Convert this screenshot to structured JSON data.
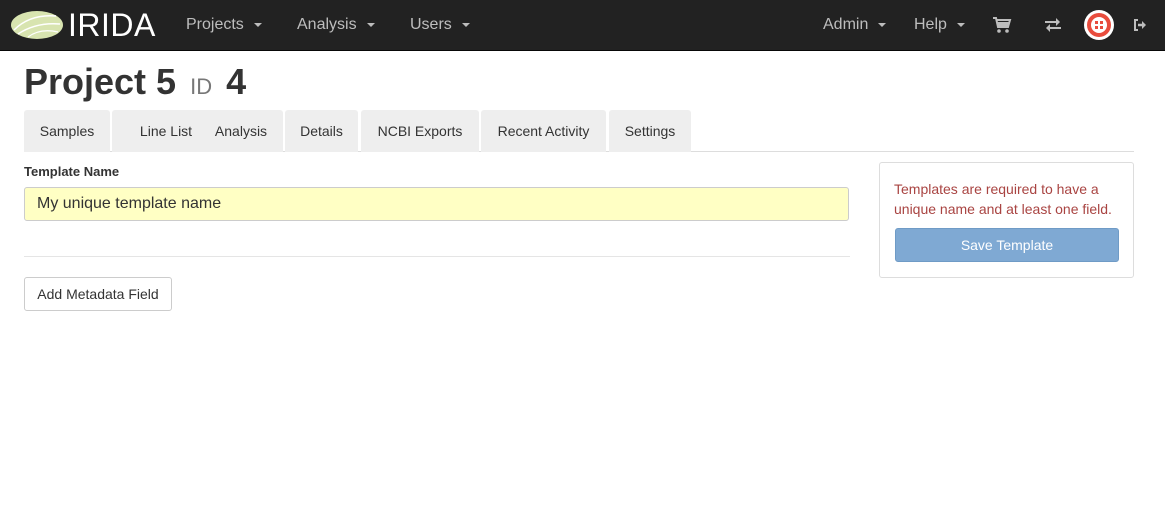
{
  "navbar": {
    "brand": "IRIDA",
    "menu": [
      {
        "label": "Projects"
      },
      {
        "label": "Analysis"
      },
      {
        "label": "Users"
      }
    ],
    "right_menu": [
      {
        "label": "Admin"
      },
      {
        "label": "Help"
      }
    ],
    "icons": [
      "shopping-cart-icon",
      "transfer-icon",
      "user-avatar",
      "sign-out-icon"
    ]
  },
  "page": {
    "title": "Project 5",
    "id_label": "ID",
    "id_value": "4"
  },
  "tabs": [
    {
      "label": "Samples"
    },
    {
      "label": "Line List"
    },
    {
      "label": "Analysis"
    },
    {
      "label": "Details"
    },
    {
      "label": "NCBI Exports"
    },
    {
      "label": "Recent Activity"
    },
    {
      "label": "Settings"
    }
  ],
  "form": {
    "template_name_label": "Template Name",
    "template_name_value": "My unique template name",
    "add_field_button": "Add Metadata Field"
  },
  "panel": {
    "message": "Templates are required to have a unique name and at least one field.",
    "save_button": "Save Template"
  },
  "colors": {
    "navbar": "#222222",
    "input_highlight": "#ffffc4",
    "error_text": "#a94442",
    "primary_disabled": "#7fa9d3"
  }
}
